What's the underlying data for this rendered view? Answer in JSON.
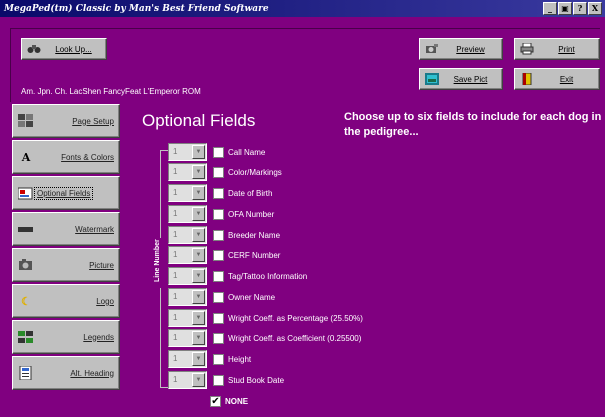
{
  "window": {
    "title": "MegaPed(tm) Classic by Man's Best Friend Software",
    "title_buttons": [
      "?",
      "X"
    ]
  },
  "toolbar": {
    "lookup_label": "Look Up...",
    "preview_label": "Preview",
    "print_label": "Print",
    "save_pict_label": "Save Pict",
    "exit_label": "Exit"
  },
  "dog_name": "Am. Jpn. Ch. LacShen FancyFeat L'Emperor ROM",
  "sidebar": {
    "items": [
      {
        "label": "Page Setup",
        "icon": "page-setup-icon"
      },
      {
        "label": "Fonts & Colors",
        "icon": "font-icon"
      },
      {
        "label": "Optional Fields",
        "icon": "fields-icon",
        "active": true
      },
      {
        "label": "Watermark",
        "icon": "watermark-icon"
      },
      {
        "label": "Picture",
        "icon": "camera-icon"
      },
      {
        "label": "Logo",
        "icon": "logo-icon"
      },
      {
        "label": "Legends",
        "icon": "legends-icon"
      },
      {
        "label": "Alt. Heading",
        "icon": "heading-icon"
      }
    ]
  },
  "main": {
    "title": "Optional Fields",
    "instructions": "Choose up to six fields to include for each dog in the pedigree...",
    "line_number_label": "Line Number",
    "fields": [
      {
        "line": "1",
        "label": "Call Name"
      },
      {
        "line": "1",
        "label": "Color/Markings"
      },
      {
        "line": "1",
        "label": "Date of Birth"
      },
      {
        "line": "1",
        "label": "OFA Number"
      },
      {
        "line": "1",
        "label": "Breeder Name"
      },
      {
        "line": "1",
        "label": "CERF Number"
      },
      {
        "line": "1",
        "label": "Tag/Tattoo Information"
      },
      {
        "line": "1",
        "label": "Owner Name"
      },
      {
        "line": "1",
        "label": "Wright Coeff. as Percentage (25.50%)"
      },
      {
        "line": "1",
        "label": "Wright Coeff. as Coefficient (0.25500)"
      },
      {
        "line": "1",
        "label": "Height"
      },
      {
        "line": "1",
        "label": "Stud Book Date"
      }
    ],
    "none_label": "NONE",
    "none_checked": "✔"
  },
  "colors": {
    "panel": "#800080",
    "button_face": "#c0c0c0",
    "title_bar": "#0a0a6a"
  }
}
